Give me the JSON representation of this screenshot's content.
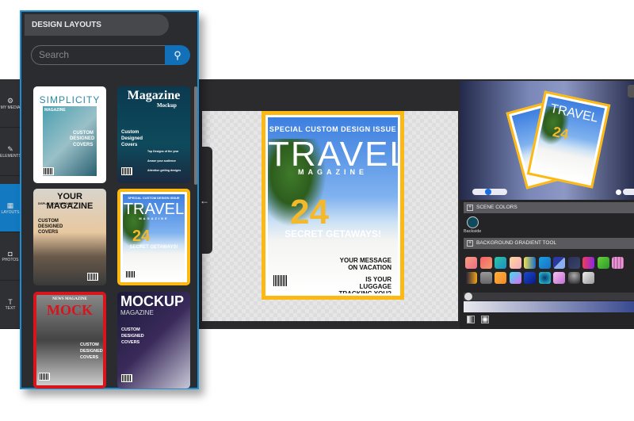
{
  "sidebar": {
    "items": [
      {
        "label": "MY MEDIA",
        "icon": "media-icon"
      },
      {
        "label": "ELEMENTS",
        "icon": "elements-icon"
      },
      {
        "label": "LAYOUTS",
        "icon": "layouts-icon",
        "active": true
      },
      {
        "label": "PHOTOS",
        "icon": "camera-icon"
      },
      {
        "label": "TEXT",
        "icon": "text-icon"
      }
    ]
  },
  "panel": {
    "title": "DESIGN LAYOUTS",
    "search_placeholder": "Search",
    "layouts": [
      {
        "title": "SIMPLICITY",
        "sub": "MAGAZINE",
        "lines": [
          "CUSTOM",
          "DESIGNED",
          "COVERS"
        ]
      },
      {
        "title": "Magazine",
        "sub": "Mockup",
        "lines": [
          "Custom",
          "Designed",
          "Covers",
          "Top Designs of the year",
          "Amaze your audience",
          "Attention getting designs"
        ]
      },
      {
        "title": "YOUR MAGAZINE",
        "sub": "DISPLAY YOUR MESSAGE",
        "lines": [
          "CUSTOM",
          "DESIGNED",
          "COVERS"
        ]
      },
      {
        "title": "TRAVEL",
        "sub": "MAGAZINE",
        "top": "SPECIAL CUSTOM DESIGN ISSUE",
        "num": "24",
        "lines": [
          "SECRET GETAWAYS!"
        ]
      },
      {
        "title": "MOCK",
        "sub": "NEWS MAGAZINE",
        "lines": [
          "CUSTOM",
          "DESIGNED",
          "COVERS"
        ]
      },
      {
        "title": "MOCKUP",
        "sub": "MAGAZINE",
        "lines": [
          "CUSTOM",
          "DESIGNED",
          "COVERS"
        ]
      }
    ]
  },
  "cover": {
    "top": "SPECIAL CUSTOM DESIGN ISSUE",
    "title": "TRAVEL",
    "sub": "MAGAZINE",
    "num": "24",
    "headline": "SECRET GETAWAYS!",
    "msg1": "YOUR MESSAGE ON VACATION",
    "msg2": "IS YOUR LUGGAGE TRACKING YOU?",
    "accent": "#fdb913"
  },
  "right": {
    "scene_colors": "SCENE COLORS",
    "backside_label": "Backside",
    "backside_color": "#0e4a5c",
    "gradient_tool": "BACKGROUND GRADIENT TOOL",
    "swatches": [
      "linear-gradient(135deg,#f6a07a,#f06a8a)",
      "linear-gradient(135deg,#f5606a,#f59a6a)",
      "linear-gradient(135deg,#2ec4a0,#1a90c8)",
      "linear-gradient(135deg,#fcd99a,#f7a7c0)",
      "linear-gradient(90deg,#f4e04a,#1a6fc8)",
      "linear-gradient(135deg,#1aa0e0,#1a6fc8)",
      "linear-gradient(135deg,#2a3aa0 50%,#8ab0f0 50%)",
      "linear-gradient(135deg,#2a3050,#3a4470)",
      "linear-gradient(90deg,#f53a5a,#8a2ae0)",
      "linear-gradient(135deg,#6ad03a,#2a9a2a)",
      "repeating-linear-gradient(90deg,#e79ad0 0 2px,#c46ab0 2px 4px)",
      "linear-gradient(90deg,#1a1a3a,#f4a41a)",
      "linear-gradient(#999,#666)",
      "linear-gradient(135deg,#fcb03a,#f58a2a)",
      "linear-gradient(135deg,#3ae0f0,#e06af0)",
      "linear-gradient(135deg,#1a4ad0,#0a1a80)",
      "radial-gradient(circle,#0a3a70,#2ad0e0)",
      "linear-gradient(135deg,#f7c0f0,#c070d0)",
      "radial-gradient(circle at 50% 30%,#aaa,#222)",
      "linear-gradient(135deg,#eee,#999)"
    ]
  }
}
